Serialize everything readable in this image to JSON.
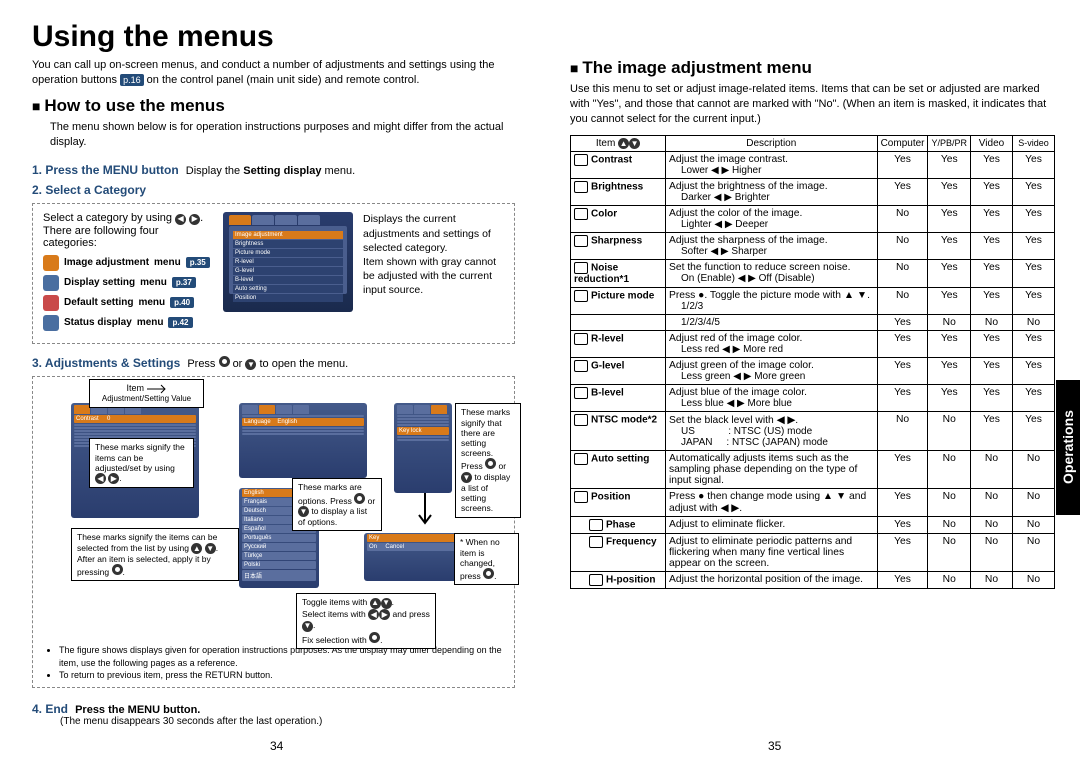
{
  "title": "Using the menus",
  "intro": "You can call up on-screen menus, and conduct a number of adjustments and settings using the operation buttons",
  "intro_ref": "p.16",
  "intro2": "on the control panel (main unit side) and remote control.",
  "section_how": "How to use the menus",
  "how_intro": "The menu shown below is for operation instructions purposes and might differ from the actual display.",
  "step1_label": "1. Press the MENU button",
  "step1_text": "Display the",
  "step1_bold": "Setting display",
  "step1_text2": "menu.",
  "step2_label": "2. Select a Category",
  "cat_intro1": "Select a category by using",
  "cat_intro2": "There are following four categories:",
  "cat_right": "Displays the current adjustments and settings of selected category.\nItem shown with gray cannot be adjusted with the current input source.",
  "categories": [
    {
      "name": "Image adjustment",
      "menu": "menu",
      "page": "p.35"
    },
    {
      "name": "Display setting",
      "menu": "menu",
      "page": "p.37"
    },
    {
      "name": "Default setting",
      "menu": "menu",
      "page": "p.40"
    },
    {
      "name": "Status display",
      "menu": "menu",
      "page": "p.42"
    }
  ],
  "step3_label": "3. Adjustments & Settings",
  "step3_text": "Press",
  "step3_text2": "or",
  "step3_text3": "to open the menu.",
  "callout_item": "Item",
  "callout_adjval": "Adjustment/Setting Value",
  "callout_c1": "These marks signify the items can be selected from the list by using",
  "callout_c1b": "After an item is selected, apply it by pressing",
  "callout_c3": "These marks are options.\nPress",
  "callout_c3b": "or",
  "callout_c3c": "to display a list of options.",
  "callout_c4a": "Toggle items with",
  "callout_c4b": "Select items with",
  "callout_c4c": "and press",
  "callout_c4d": "Fix selection with",
  "callout_c5": "These marks signify that there are setting screens. Press",
  "callout_c5b": "or",
  "callout_c5c": "to display a list of setting screens.",
  "callout_c6": "* When no item is changed, press",
  "callout_marks": "These marks signify the items can be adjusted/set by using",
  "bullets": [
    "The figure shows displays given for operation instructions purposes.  As the display may differ depending on the item, use the following pages as a reference.",
    "To return to previous item, press the RETURN button."
  ],
  "step4_label": "4. End",
  "step4_text": "Press the MENU button.",
  "step4_note": "(The menu disappears 30 seconds after the last operation.)",
  "page_left_num": "34",
  "page_right_num": "35",
  "sidetab": "Operations",
  "section_image": "The image adjustment menu",
  "image_intro": "Use this menu to set or adjust image-related items. Items that can be set or adjusted are marked with \"Yes\", and those that cannot are marked with \"No\". (When an item is masked, it indicates that you cannot select for the current input.)",
  "table_headers": [
    "Item",
    "Description",
    "Computer",
    "Y/PB/PR",
    "Video",
    "S-video"
  ],
  "rows": [
    {
      "item": "Contrast",
      "desc": "Adjust the image contrast.",
      "sub": "Lower ◀ ▶ Higher",
      "c": "Yes",
      "y": "Yes",
      "v": "Yes",
      "s": "Yes"
    },
    {
      "item": "Brightness",
      "desc": "Adjust the brightness of the image.",
      "sub": "Darker ◀ ▶ Brighter",
      "c": "Yes",
      "y": "Yes",
      "v": "Yes",
      "s": "Yes"
    },
    {
      "item": "Color",
      "desc": "Adjust the color of the image.",
      "sub": "Lighter ◀ ▶ Deeper",
      "c": "No",
      "y": "Yes",
      "v": "Yes",
      "s": "Yes"
    },
    {
      "item": "Sharpness",
      "desc": "Adjust the sharpness of the image.",
      "sub": "Softer ◀ ▶ Sharper",
      "c": "No",
      "y": "Yes",
      "v": "Yes",
      "s": "Yes"
    },
    {
      "item": "Noise reduction*1",
      "desc": "Set the function to reduce screen noise.",
      "sub": "On (Enable) ◀ ▶ Off (Disable)",
      "c": "No",
      "y": "Yes",
      "v": "Yes",
      "s": "Yes"
    },
    {
      "item": "Picture mode",
      "desc": "Press ●. Toggle the picture mode with ▲ ▼.",
      "sub": "1/2/3",
      "sub2": "1/2/3/4/5",
      "c": "No",
      "y": "Yes",
      "v": "Yes",
      "s": "Yes",
      "c2": "Yes",
      "y2": "No",
      "v2": "No",
      "s2": "No"
    },
    {
      "item": "R-level",
      "desc": "Adjust red of the image color.",
      "sub": "Less red ◀ ▶ More red",
      "c": "Yes",
      "y": "Yes",
      "v": "Yes",
      "s": "Yes"
    },
    {
      "item": "G-level",
      "desc": "Adjust green of the image color.",
      "sub": "Less green ◀ ▶ More green",
      "c": "Yes",
      "y": "Yes",
      "v": "Yes",
      "s": "Yes"
    },
    {
      "item": "B-level",
      "desc": "Adjust blue of the image color.",
      "sub": "Less blue ◀ ▶ More blue",
      "c": "Yes",
      "y": "Yes",
      "v": "Yes",
      "s": "Yes"
    },
    {
      "item": "NTSC mode*2",
      "desc": "Set the black level with ◀ ▶.",
      "sub": "US            : NTSC (US) mode\nJAPAN     : NTSC (JAPAN) mode",
      "c": "No",
      "y": "No",
      "v": "Yes",
      "s": "Yes"
    },
    {
      "item": "Auto setting",
      "desc": "Automatically adjusts items such as the sampling phase depending on the type of input signal.",
      "c": "Yes",
      "y": "No",
      "v": "No",
      "s": "No"
    },
    {
      "item": "Position",
      "desc": "Press ● then change mode using ▲ ▼ and adjust with ◀ ▶.",
      "c": "Yes",
      "y": "No",
      "v": "No",
      "s": "No"
    },
    {
      "item": "Phase",
      "desc": "Adjust to eliminate flicker.",
      "c": "Yes",
      "y": "No",
      "v": "No",
      "s": "No",
      "indent": true
    },
    {
      "item": "Frequency",
      "desc": "Adjust to eliminate periodic patterns and flickering when many fine vertical lines appear on the screen.",
      "c": "Yes",
      "y": "No",
      "v": "No",
      "s": "No",
      "indent": true
    },
    {
      "item": "H-position",
      "desc": "Adjust the horizontal position of the image.",
      "c": "Yes",
      "y": "No",
      "v": "No",
      "s": "No",
      "indent": true
    }
  ]
}
